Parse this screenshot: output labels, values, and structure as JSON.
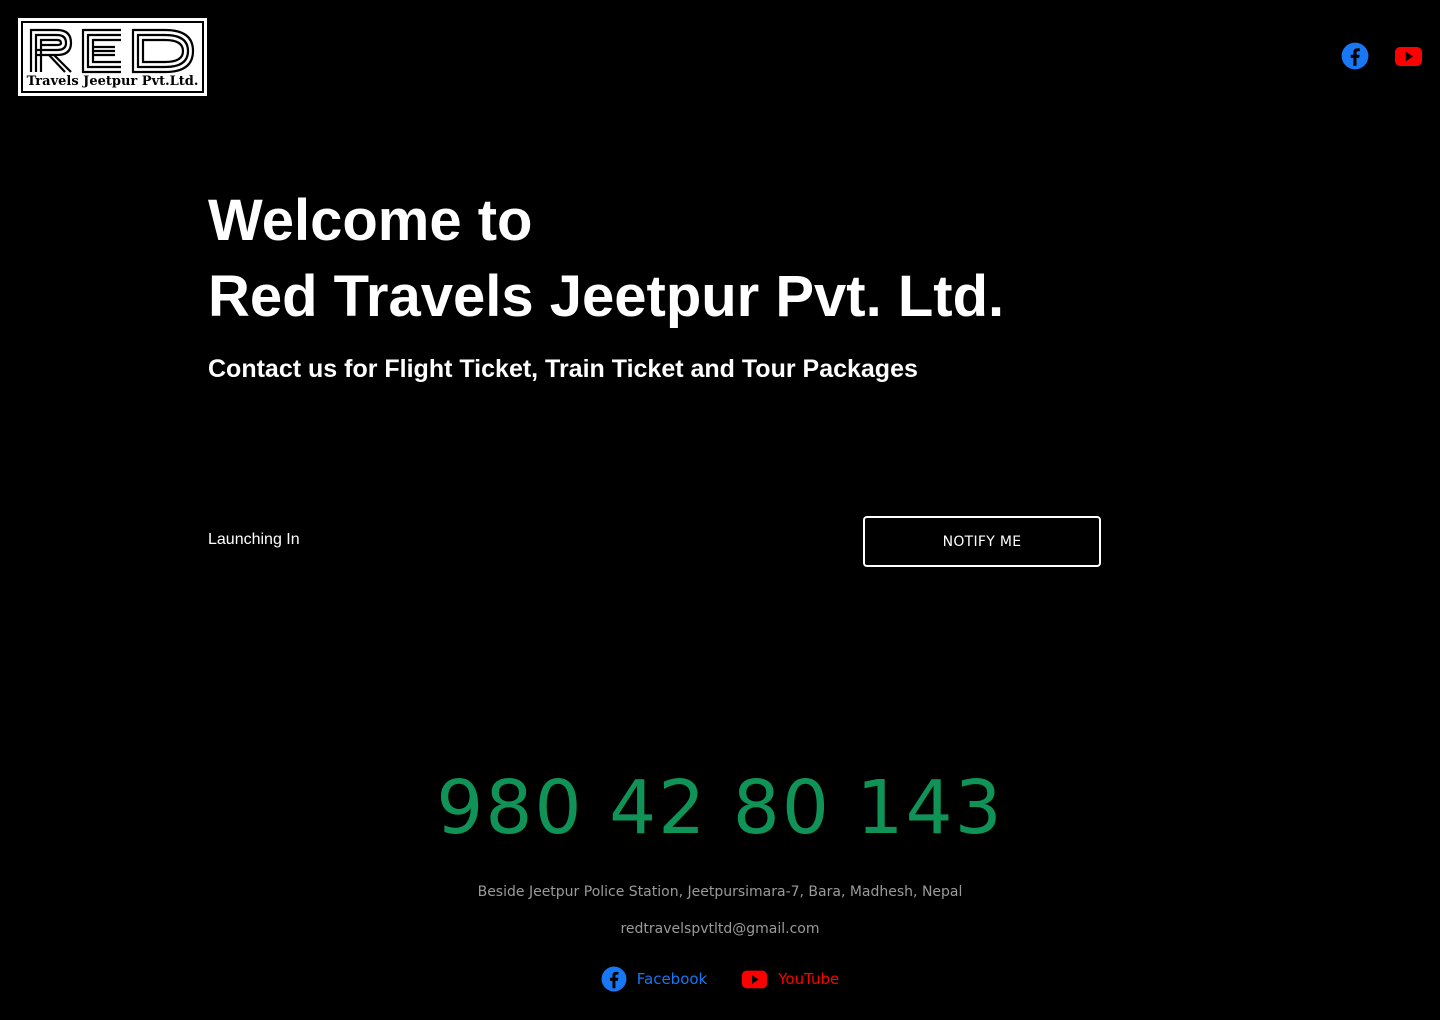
{
  "logo": {
    "big_text": "RED",
    "sub_text": "Travels Jeetpur Pvt.Ltd."
  },
  "header": {
    "social": [
      {
        "name": "facebook",
        "icon": "facebook-icon",
        "color": "#1877f2"
      },
      {
        "name": "youtube",
        "icon": "youtube-icon",
        "color": "#ff0000"
      }
    ]
  },
  "hero": {
    "welcome_line1": "Welcome to",
    "welcome_line2": "Red Travels Jeetpur Pvt. Ltd.",
    "tagline": "Contact us for Flight Ticket, Train Ticket and Tour Packages",
    "launching_label": "Launching In",
    "notify_button": "NOTIFY ME"
  },
  "contact": {
    "phone": "980 42 80 143",
    "phone_color": "#0f9356",
    "address": "Beside Jeetpur Police Station, Jeetpursimara-7, Bara, Madhesh, Nepal",
    "email": "redtravelspvtltd@gmail.com"
  },
  "footer": {
    "facebook_label": "Facebook",
    "youtube_label": "YouTube"
  }
}
